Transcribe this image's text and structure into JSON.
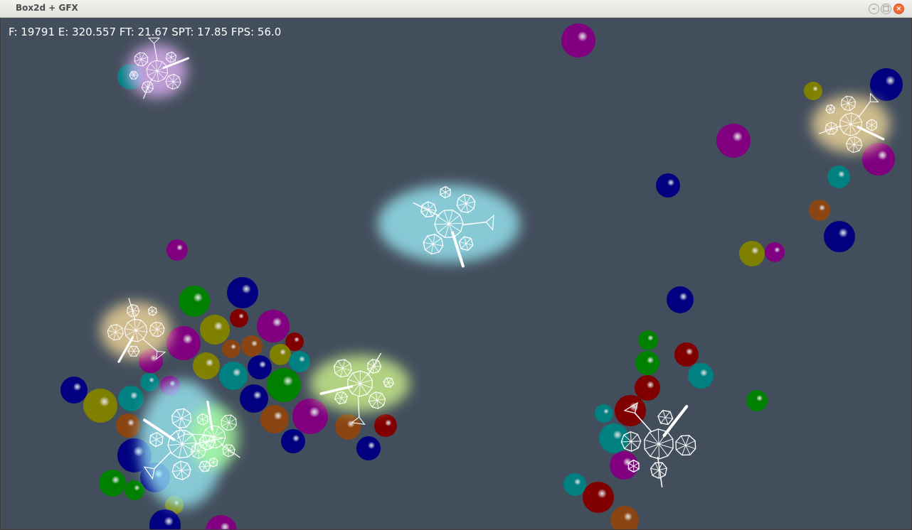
{
  "window": {
    "title": "Box2d + GFX",
    "minimize_icon": "minimize-icon",
    "maximize_icon": "maximize-icon",
    "close_icon": "close-icon"
  },
  "hud": {
    "stats": "F: 19791 E: 320.557 FT: 21.67 SPT: 17.85 FPS: 56.0"
  },
  "colors": {
    "background": "#434e5c",
    "ball_palette": [
      "#800080",
      "#008080",
      "#808000",
      "#000080",
      "#800000",
      "#008000",
      "#8b4513"
    ],
    "glow_cyan": "#9ff2ff",
    "glow_gold": "#ffe2a0",
    "glow_lime": "#d8ff90",
    "glow_green": "#a8ff9a",
    "glow_violet": "#e8b8ff"
  }
}
